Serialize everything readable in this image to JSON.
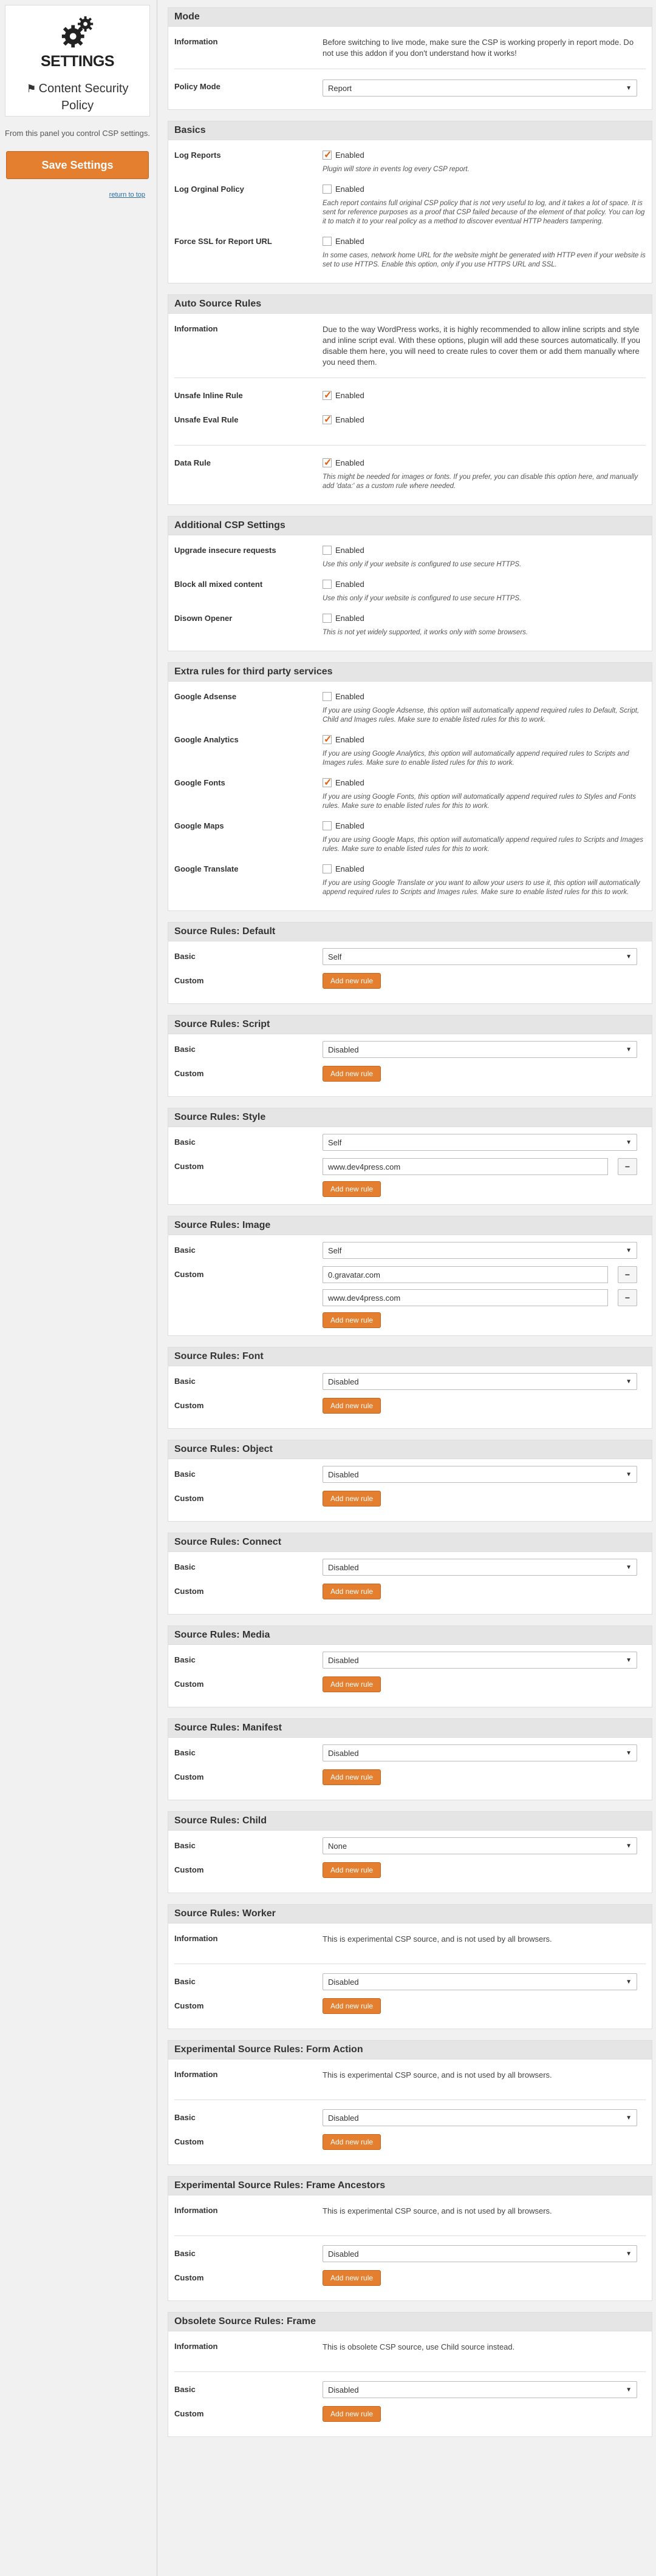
{
  "sidebar": {
    "title": "SETTINGS",
    "plugin_name": "Content Security Policy",
    "description": "From this panel you control CSP settings.",
    "save_label": "Save Settings",
    "return_label": "return to top"
  },
  "labels": {
    "enabled": "Enabled",
    "add_rule": "Add new rule",
    "information": "Information",
    "basic": "Basic",
    "custom": "Custom",
    "remove": "−"
  },
  "mode": {
    "title": "Mode",
    "info": "Before switching to live mode, make sure the CSP is working properly in report mode. Do not use this addon if you don't understand how it works!",
    "policy_label": "Policy Mode",
    "policy_value": "Report"
  },
  "basics": {
    "title": "Basics",
    "log_reports": "Log Reports",
    "log_reports_note": "Plugin will store in events log every CSP report.",
    "log_original": "Log Orginal Policy",
    "log_original_note": "Each report contains full original CSP policy that is not very useful to log, and it takes a lot of space. It is sent for reference purposes as a proof that CSP failed because of the element of that policy. You can log it to match it to your real policy as a method to discover eventual HTTP headers tampering.",
    "force_ssl": "Force SSL for Report URL",
    "force_ssl_note": "In some cases, network home URL for the website might be generated with HTTP even if your website is set to use HTTPS. Enable this option, only if you use HTTPS URL and SSL."
  },
  "auto": {
    "title": "Auto Source Rules",
    "info": "Due to the way WordPress works, it is highly recommended to allow inline scripts and style and inline script eval. With these options, plugin will add these sources automatically. If you disable them here, you will need to create rules to cover them or add them manually where you need them.",
    "inline": "Unsafe Inline Rule",
    "eval": "Unsafe Eval Rule",
    "data": "Data Rule",
    "data_note": "This might be needed for images or fonts. If you prefer, you can disable this option here, and manually add 'data:' as a custom rule where needed."
  },
  "additional": {
    "title": "Additional CSP Settings",
    "upgrade": "Upgrade insecure requests",
    "upgrade_note": "Use this only if your website is configured to use secure HTTPS.",
    "block": "Block all mixed content",
    "block_note": "Use this only if your website is configured to use secure HTTPS.",
    "disown": "Disown Opener",
    "disown_note": "This is not yet widely supported, it works only with some browsers."
  },
  "third": {
    "title": "Extra rules for third party services",
    "adsense": "Google Adsense",
    "adsense_note": "If you are using Google Adsense, this option will automatically append required rules to Default, Script, Child and Images rules. Make sure to enable listed rules for this to work.",
    "analytics": "Google Analytics",
    "analytics_note": "If you are using Google Analytics, this option will automatically append required rules to Scripts and Images rules. Make sure to enable listed rules for this to work.",
    "fonts": "Google Fonts",
    "fonts_note": "If you are using Google Fonts, this option will automatically append required rules to Styles and Fonts rules. Make sure to enable listed rules for this to work.",
    "maps": "Google Maps",
    "maps_note": "If you are using Google Maps, this option will automatically append required rules to Scripts and Images rules. Make sure to enable listed rules for this to work.",
    "translate": "Google Translate",
    "translate_note": "If you are using Google Translate or you want to allow your users to use it, this option will automatically append required rules to Scripts and Images rules. Make sure to enable listed rules for this to work."
  },
  "src": {
    "default": {
      "title": "Source Rules: Default",
      "basic": "Self"
    },
    "script": {
      "title": "Source Rules: Script",
      "basic": "Disabled"
    },
    "style": {
      "title": "Source Rules: Style",
      "basic": "Self",
      "custom": [
        "www.dev4press.com"
      ]
    },
    "image": {
      "title": "Source Rules: Image",
      "basic": "Self",
      "custom": [
        "0.gravatar.com",
        "www.dev4press.com"
      ]
    },
    "font": {
      "title": "Source Rules: Font",
      "basic": "Disabled"
    },
    "object": {
      "title": "Source Rules: Object",
      "basic": "Disabled"
    },
    "connect": {
      "title": "Source Rules: Connect",
      "basic": "Disabled"
    },
    "media": {
      "title": "Source Rules: Media",
      "basic": "Disabled"
    },
    "manifest": {
      "title": "Source Rules: Manifest",
      "basic": "Disabled"
    },
    "child": {
      "title": "Source Rules: Child",
      "basic": "None"
    },
    "worker": {
      "title": "Source Rules: Worker",
      "info": "This is experimental CSP source, and is not used by all browsers.",
      "basic": "Disabled"
    },
    "form": {
      "title": "Experimental Source Rules: Form Action",
      "info": "This is experimental CSP source, and is not used by all browsers.",
      "basic": "Disabled"
    },
    "ancestors": {
      "title": "Experimental Source Rules: Frame Ancestors",
      "info": "This is experimental CSP source, and is not used by all browsers.",
      "basic": "Disabled"
    },
    "frame": {
      "title": "Obsolete Source Rules: Frame",
      "info": "This is obsolete CSP source, use Child source instead.",
      "basic": "Disabled"
    }
  }
}
